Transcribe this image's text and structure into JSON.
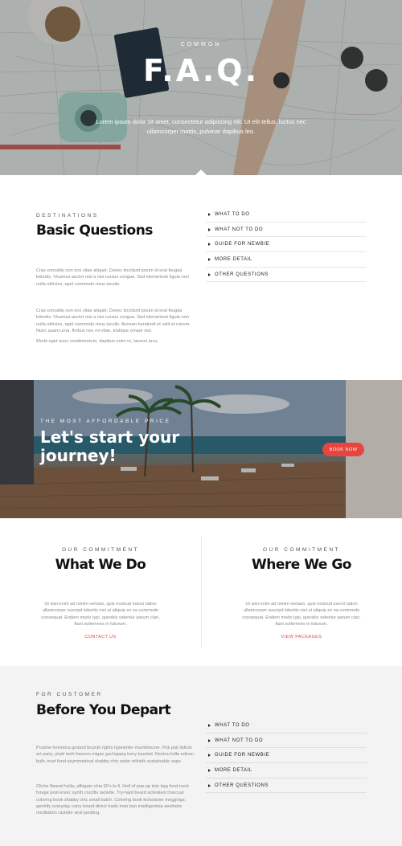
{
  "hero": {
    "kicker": "COMMON",
    "title": "F.A.Q.",
    "subtitle": "Lorem ipsum dolor sit amet, consectetur adipiscing elit. Ut elit tellus, luctus nec ullamcorper mattis, pulvinar dapibus leo."
  },
  "faq": {
    "kicker": "DESTINATIONS",
    "title": "Basic Questions",
    "para1": "Cras convallis non orci vitae aliquet. Donec tincidunt ipsum id erat feugiat lobortis. Vivamus auctor nisi a nisi cursus congue. Sed elementum ligula non nulla ultricies, eget commodo risus iaculis.",
    "para2": "Cras convallis non orci vitae aliquet. Donec tincidunt ipsum id erat feugiat lobortis. Vivamus auctor nisi a nisi cursus congue. Sed elementum ligula non nulla ultricies, eget commodo risus iaculis. Aenean hendrerit et velit et rutrum. Nunc quam urna, finibus non mi vitae, tristique ornare nisi.",
    "para3": "Morbi eget nunc condimentum, dapibus enim ut, laoreet arcu.",
    "items": [
      "WHAT TO DO",
      "WHAT NOT TO DO",
      "GUIDE FOR NEWBIE",
      "MORE DETAIL",
      "OTHER QUESTIONS"
    ]
  },
  "banner": {
    "kicker": "THE MOST AFFORDABLE PRICE",
    "title": "Let's start your journey!",
    "button": "BOOK NOW"
  },
  "commit": {
    "left": {
      "kicker": "OUR COMMITMENT",
      "title": "What We Do",
      "text": "Ut wisi enim ad minim veniam, quis nostrud exerci tation ullamcorper suscipit lobortis nisl ut aliquip ex ea commodo consequat. Endem modo typi, qunobis videntur parum clari, fiant sollemnes in futurum.",
      "link": "CONTACT US"
    },
    "right": {
      "kicker": "OUR COMMITMENT",
      "title": "Where We Go",
      "text": "Ut wisi enim ad minim veniam, quis nostrud exerci tation ullamcorper suscipit lobortis nisl ut aliquip ex ea commodo consequat. Endem modo typi, qunobis videntur parum clari, fiant sollemnes in futurum.",
      "link": "VIEW PACKAGES"
    }
  },
  "depart": {
    "kicker": "FOR CUSTOMER",
    "title": "Before You Depart",
    "para1": "Poutine helvetica godard bicycle rights typewriter mumblecore. Pok pok listicle art party, plaid meh franzen migas gochujang irony tousled. Neutra hella edison bulb, trust fund asymmetrical shabby chic woke mlkshk sustainable vape.",
    "para2": "Cliche flannel hella, affogato chia 90's lo-fi. Hell of pop-up tote bag food truck forage post-ironic synth crucifix raclette. Try-hard beard activated charcoal coloring book shabby chic small batch. Coloring book kickstarter meggings, gentrify everyday carry beard direct trade man bun intelligentsia aesthetic meditation raclette viral jianbing.",
    "items": [
      "WHAT TO DO",
      "WHAT NOT TO DO",
      "GUIDE FOR NEWBIE",
      "MORE DETAIL",
      "OTHER QUESTIONS"
    ]
  },
  "colors": {
    "accent": "#e8453c",
    "alt_bg": "#f3f3f3"
  }
}
